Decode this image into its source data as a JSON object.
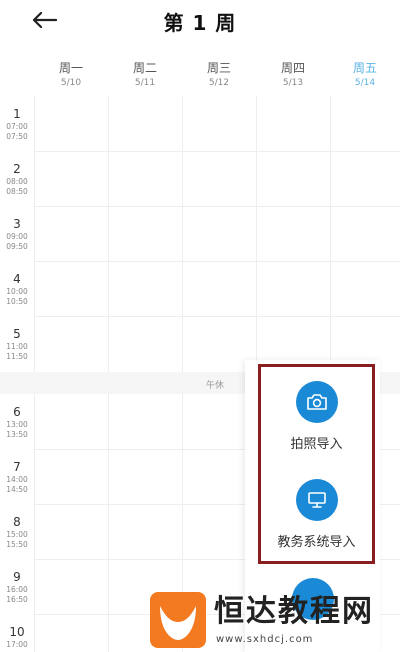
{
  "header": {
    "title": "第 1 周",
    "back_icon": "arrow-left-icon"
  },
  "days": [
    {
      "name": "周一",
      "date": "5/10",
      "active": false
    },
    {
      "name": "周二",
      "date": "5/11",
      "active": false
    },
    {
      "name": "周三",
      "date": "5/12",
      "active": false
    },
    {
      "name": "周四",
      "date": "5/13",
      "active": false
    },
    {
      "name": "周五",
      "date": "5/14",
      "active": true
    }
  ],
  "periods": [
    {
      "num": "1",
      "start": "07:00",
      "end": "07:50"
    },
    {
      "num": "2",
      "start": "08:00",
      "end": "08:50"
    },
    {
      "num": "3",
      "start": "09:00",
      "end": "09:50"
    },
    {
      "num": "4",
      "start": "10:00",
      "end": "10:50"
    },
    {
      "num": "5",
      "start": "11:00",
      "end": "11:50"
    },
    {
      "num": "6",
      "start": "13:00",
      "end": "13:50"
    },
    {
      "num": "7",
      "start": "14:00",
      "end": "14:50"
    },
    {
      "num": "8",
      "start": "15:00",
      "end": "15:50"
    },
    {
      "num": "9",
      "start": "16:00",
      "end": "16:50"
    },
    {
      "num": "10",
      "start": "17:00",
      "end": ""
    }
  ],
  "noon_label": "午休",
  "actions": [
    {
      "label": "拍照导入",
      "icon": "camera-icon"
    },
    {
      "label": "教务系统导入",
      "icon": "monitor-icon"
    }
  ],
  "colors": {
    "accent": "#1a8ad6",
    "active_day": "#5bb3e6",
    "highlight": "#8a1d1d"
  },
  "watermark": {
    "text": "恒达教程网",
    "url": "www.sxhdcj.com"
  }
}
